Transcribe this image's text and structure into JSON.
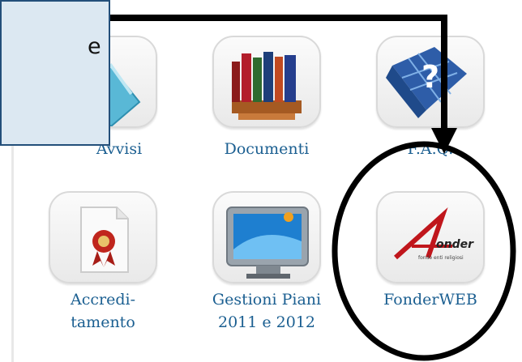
{
  "callout": {
    "text": "e"
  },
  "tiles": [
    {
      "label": "Avvisi",
      "icon": "folder-icon"
    },
    {
      "label": "Documenti",
      "icon": "books-icon"
    },
    {
      "label": "F.A.Q.",
      "icon": "faq-icon"
    },
    {
      "label": "Accredi-\ntamento",
      "icon": "certificate-icon"
    },
    {
      "label": "Gestioni Piani\n2011 e 2012",
      "icon": "monitor-icon"
    },
    {
      "label": "FonderWEB",
      "icon": "fonder-logo-icon"
    }
  ],
  "logo": {
    "text": "onder",
    "tagline": "fondo enti religiosi"
  }
}
